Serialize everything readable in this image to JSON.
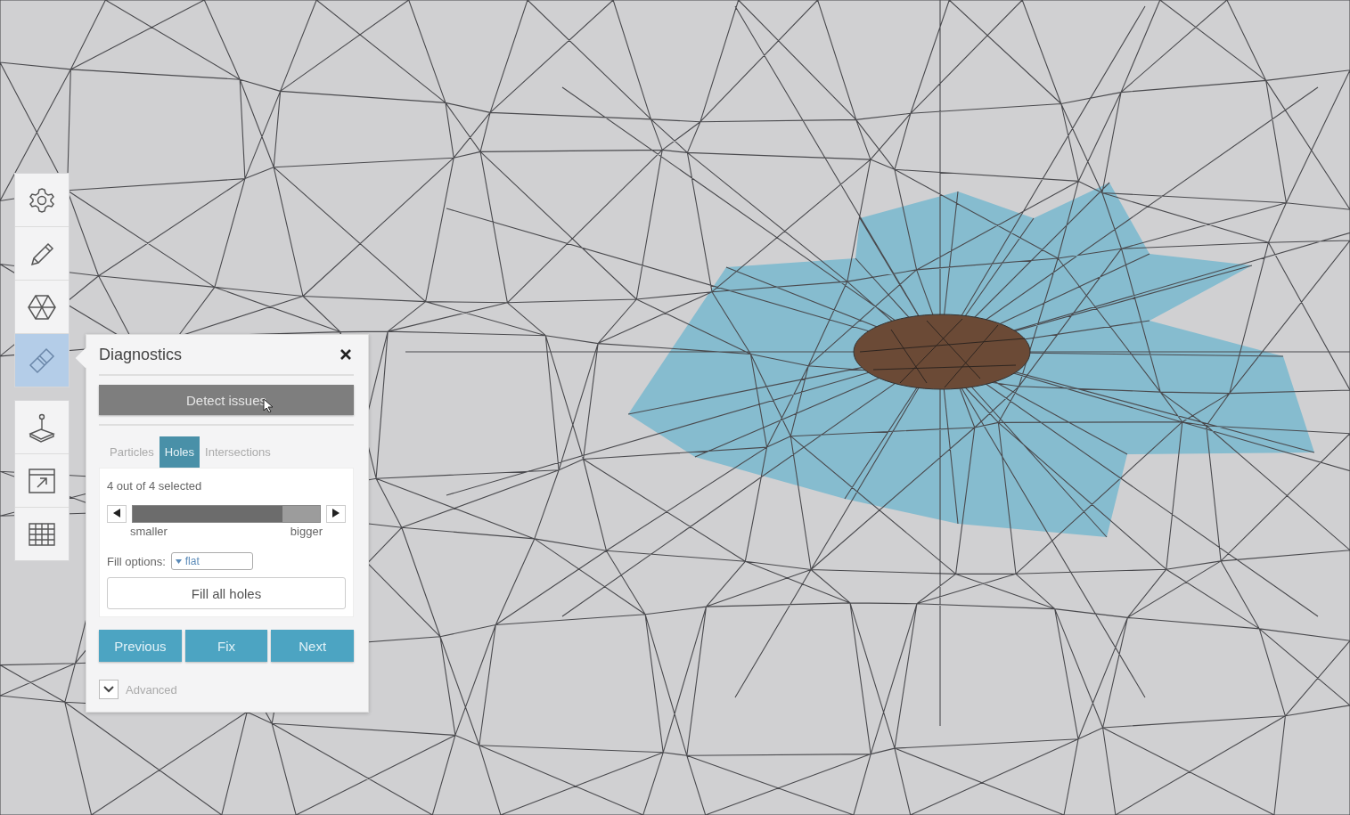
{
  "toolbar": {
    "groups": [
      [
        {
          "kind": "gear",
          "selected": false
        },
        {
          "kind": "pencil",
          "selected": false
        },
        {
          "kind": "mesh",
          "selected": false
        },
        {
          "kind": "bandage",
          "selected": true
        }
      ],
      [
        {
          "kind": "joystick",
          "selected": false
        },
        {
          "kind": "export",
          "selected": false
        },
        {
          "kind": "table",
          "selected": false
        }
      ]
    ]
  },
  "panel": {
    "title": "Diagnostics",
    "detect_button": "Detect issues",
    "tabs": [
      {
        "label": "Particles",
        "selected": false
      },
      {
        "label": "Holes",
        "selected": true
      },
      {
        "label": "Intersections",
        "selected": false
      }
    ],
    "selection_count": "4 out of 4 selected",
    "slider": {
      "level": 0.8,
      "min_label": "smaller",
      "max_label": "bigger"
    },
    "fill_options": {
      "label": "Fill options:",
      "value": "flat"
    },
    "fill_all_button": "Fill all holes",
    "nav_buttons": [
      "Previous",
      "Fix",
      "Next"
    ],
    "advanced": {
      "label": "Advanced",
      "expanded": false
    }
  }
}
